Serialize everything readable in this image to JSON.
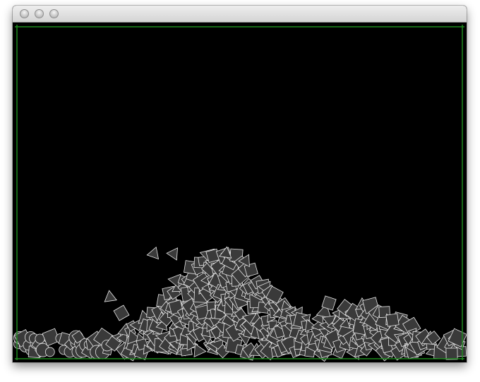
{
  "window": {
    "buttons": [
      "close-button",
      "minimize-button",
      "zoom-button"
    ]
  },
  "scene": {
    "background_color": "#000000",
    "wall_color": "#1e8a1e",
    "shape_fill": "#3a3a3a",
    "shape_stroke": "#e8e8e8",
    "shape_kinds": [
      "circle",
      "square",
      "triangle"
    ]
  }
}
